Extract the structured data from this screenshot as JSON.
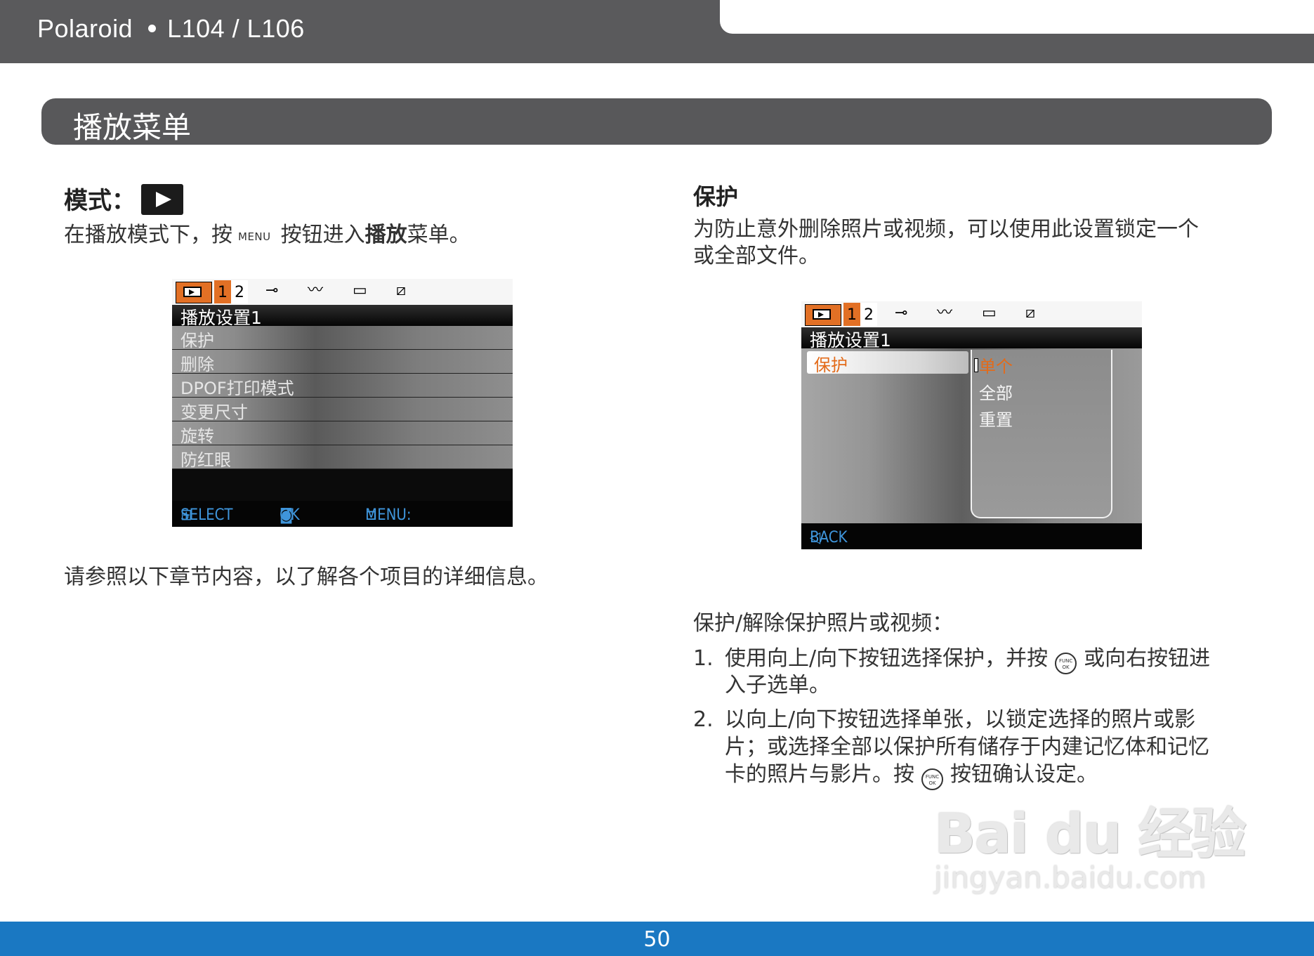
{
  "header": {
    "brand": "Polaroid",
    "model": "L104 / L106"
  },
  "section": {
    "title": "播放菜单"
  },
  "left": {
    "mode_label": "模式：",
    "intro_part1": "在播放模式下，按",
    "menu_key": "MENU",
    "intro_part2": "按钮进入",
    "intro_bold": "播放",
    "intro_part3": "菜单。",
    "refer_text": "请参照以下章节内容，以了解各个项目的详细信息。"
  },
  "screen1": {
    "tab_nums": [
      "1",
      "2"
    ],
    "title": "播放设置1",
    "items": [
      "保护",
      "删除",
      "DPOF打印模式",
      "变更尺寸",
      "旋转",
      "防红眼"
    ],
    "foot_select": "SELECT",
    "foot_ok": "OK",
    "foot_menu": "MENU:"
  },
  "right": {
    "heading": "保护",
    "desc_line1": "为防止意外删除照片或视频，可以使用此设置锁定一个",
    "desc_line2": "或全部文件。",
    "procedure_title": "保护/解除保护照片或视频：",
    "step1_num": "1.",
    "step1_a": "使用向上/向下按钮选择保护，并按",
    "step1_b": "或向右按钮进",
    "step1_c": "入子选单。",
    "step2_num": "2.",
    "step2_a": "以向上/向下按钮选择单张，以锁定选择的照片或影",
    "step2_b": "片；或选择全部以保护所有储存于内建记忆体和记忆",
    "step2_c": "卡的照片与影片。按",
    "step2_d": "按钮确认设定。",
    "func_top": "FUNC",
    "func_bottom": "OK"
  },
  "screen2": {
    "tab_nums": [
      "1",
      "2"
    ],
    "title": "播放设置1",
    "selected_item": "保护",
    "submenu": [
      "单个",
      "全部",
      "重置"
    ],
    "foot_back": "BACK"
  },
  "watermark": {
    "big": "Bai du 经验",
    "small": "jingyan.baidu.com"
  },
  "footer": {
    "page_number": "50"
  },
  "colors": {
    "header_gray": "#5a5a5c",
    "footer_blue": "#1a78c2",
    "tab_orange": "#e27025",
    "highlight_orange": "#e36b1a",
    "foot_text_blue": "#3f95db"
  }
}
